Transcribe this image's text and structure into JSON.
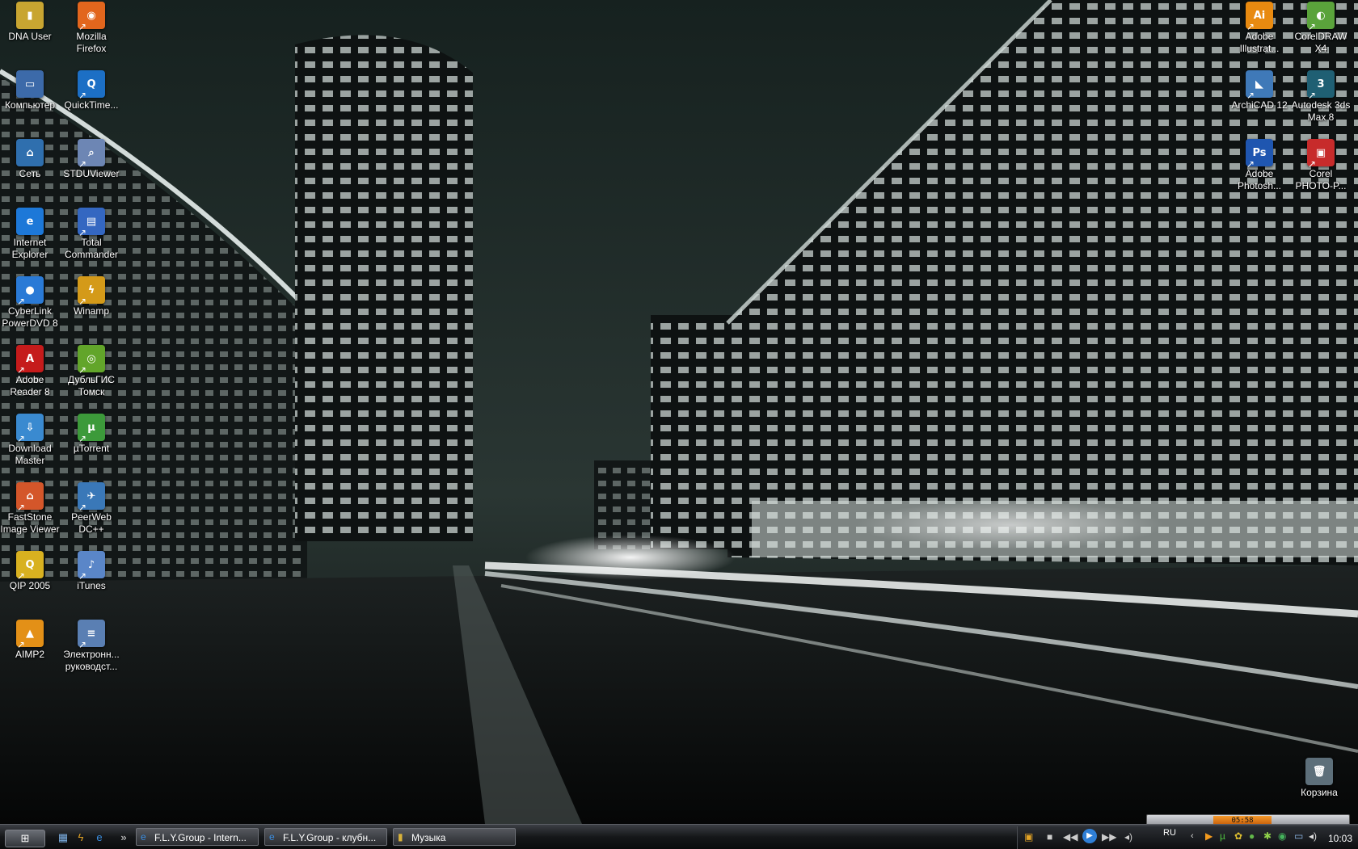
{
  "desktop": {
    "left_icons": [
      {
        "label": "DNA User",
        "glyph": "▮",
        "color": "#c8a531",
        "shortcut": false,
        "icon": "folder-icon"
      },
      {
        "label": "Mozilla Firefox",
        "glyph": "◉",
        "color": "#e2661d",
        "shortcut": true,
        "icon": "firefox-icon"
      },
      {
        "label": "Компьютер",
        "glyph": "▭",
        "color": "#3c6aa9",
        "shortcut": false,
        "icon": "computer-icon"
      },
      {
        "label": "QuickTime...",
        "glyph": "Q",
        "color": "#1c6fc5",
        "shortcut": true,
        "icon": "quicktime-icon"
      },
      {
        "label": "Сеть",
        "glyph": "⌂",
        "color": "#2f6fae",
        "shortcut": false,
        "icon": "network-icon"
      },
      {
        "label": "STDUViewer",
        "glyph": "⌕",
        "color": "#6d86b4",
        "shortcut": true,
        "icon": "stduviewer-icon"
      },
      {
        "label": "Internet Explorer",
        "glyph": "e",
        "color": "#1d78d8",
        "shortcut": false,
        "icon": "internet-explorer-icon"
      },
      {
        "label": "Total Commander",
        "glyph": "▤",
        "color": "#3467c1",
        "shortcut": true,
        "icon": "total-commander-icon"
      },
      {
        "label": "CyberLink PowerDVD 8",
        "glyph": "●",
        "color": "#2a7ad6",
        "shortcut": true,
        "icon": "powerdvd-icon"
      },
      {
        "label": "Winamp",
        "glyph": "ϟ",
        "color": "#d49a19",
        "shortcut": true,
        "icon": "winamp-icon"
      },
      {
        "label": "Adobe Reader 8",
        "glyph": "A",
        "color": "#c51b1b",
        "shortcut": true,
        "icon": "adobe-reader-icon"
      },
      {
        "label": "ДубльГИС Томск",
        "glyph": "◎",
        "color": "#62a52a",
        "shortcut": true,
        "icon": "dublgis-icon"
      },
      {
        "label": "Download Master",
        "glyph": "⇩",
        "color": "#3a8ad0",
        "shortcut": true,
        "icon": "download-master-icon"
      },
      {
        "label": "µTorrent",
        "glyph": "µ",
        "color": "#3c9a3a",
        "shortcut": true,
        "icon": "utorrent-icon"
      },
      {
        "label": "FastStone Image Viewer",
        "glyph": "⌂",
        "color": "#d4562a",
        "shortcut": true,
        "icon": "faststone-icon"
      },
      {
        "label": "PeerWeb DC++",
        "glyph": "✈",
        "color": "#3a78b8",
        "shortcut": true,
        "icon": "peerweb-icon"
      },
      {
        "label": "QIP 2005",
        "glyph": "Q",
        "color": "#d8b120",
        "shortcut": true,
        "icon": "qip-icon"
      },
      {
        "label": "iTunes",
        "glyph": "♪",
        "color": "#5a86c8",
        "shortcut": true,
        "icon": "itunes-icon"
      },
      {
        "label": "AIMP2",
        "glyph": "▲",
        "color": "#e39017",
        "shortcut": true,
        "icon": "aimp-icon"
      },
      {
        "label": "Электронн... руководст...",
        "glyph": "≡",
        "color": "#5a7fb3",
        "shortcut": true,
        "icon": "document-icon"
      }
    ],
    "right_icons": [
      {
        "label": "Adobe Illustrat...",
        "glyph": "Ai",
        "color": "#e88a10",
        "shortcut": true,
        "icon": "illustrator-icon"
      },
      {
        "label": "CorelDRAW X4",
        "glyph": "◐",
        "color": "#5aa33b",
        "shortcut": true,
        "icon": "coreldraw-icon"
      },
      {
        "label": "ArchiCAD 12",
        "glyph": "◣",
        "color": "#3f79b8",
        "shortcut": true,
        "icon": "archicad-icon"
      },
      {
        "label": "Autodesk 3ds Max 8",
        "glyph": "3",
        "color": "#1f5f73",
        "shortcut": true,
        "icon": "3ds-max-icon"
      },
      {
        "label": "Adobe Photosh...",
        "glyph": "Ps",
        "color": "#1f56b0",
        "shortcut": true,
        "icon": "photoshop-icon"
      },
      {
        "label": "Corel PHOTO-P...",
        "glyph": "▣",
        "color": "#c72b2b",
        "shortcut": true,
        "icon": "corel-photopaint-icon"
      }
    ],
    "recycle_bin": {
      "label": "Корзина",
      "glyph": "🗑",
      "color": "#5d6f7a",
      "shortcut": false,
      "icon": "recycle-bin-icon"
    }
  },
  "taskbar": {
    "start_glyph": "⊞",
    "quick_launch": [
      "▦",
      "ϟ",
      "e",
      "»"
    ],
    "tasks": [
      {
        "label": "F.L.Y.Group - Intern...",
        "glyph": "e"
      },
      {
        "label": "F.L.Y.Group - клубн...",
        "glyph": "e"
      },
      {
        "label": "Музыка",
        "glyph": "▮"
      }
    ],
    "language": "RU",
    "clock": "10:03",
    "aimp_time": "05:58"
  }
}
